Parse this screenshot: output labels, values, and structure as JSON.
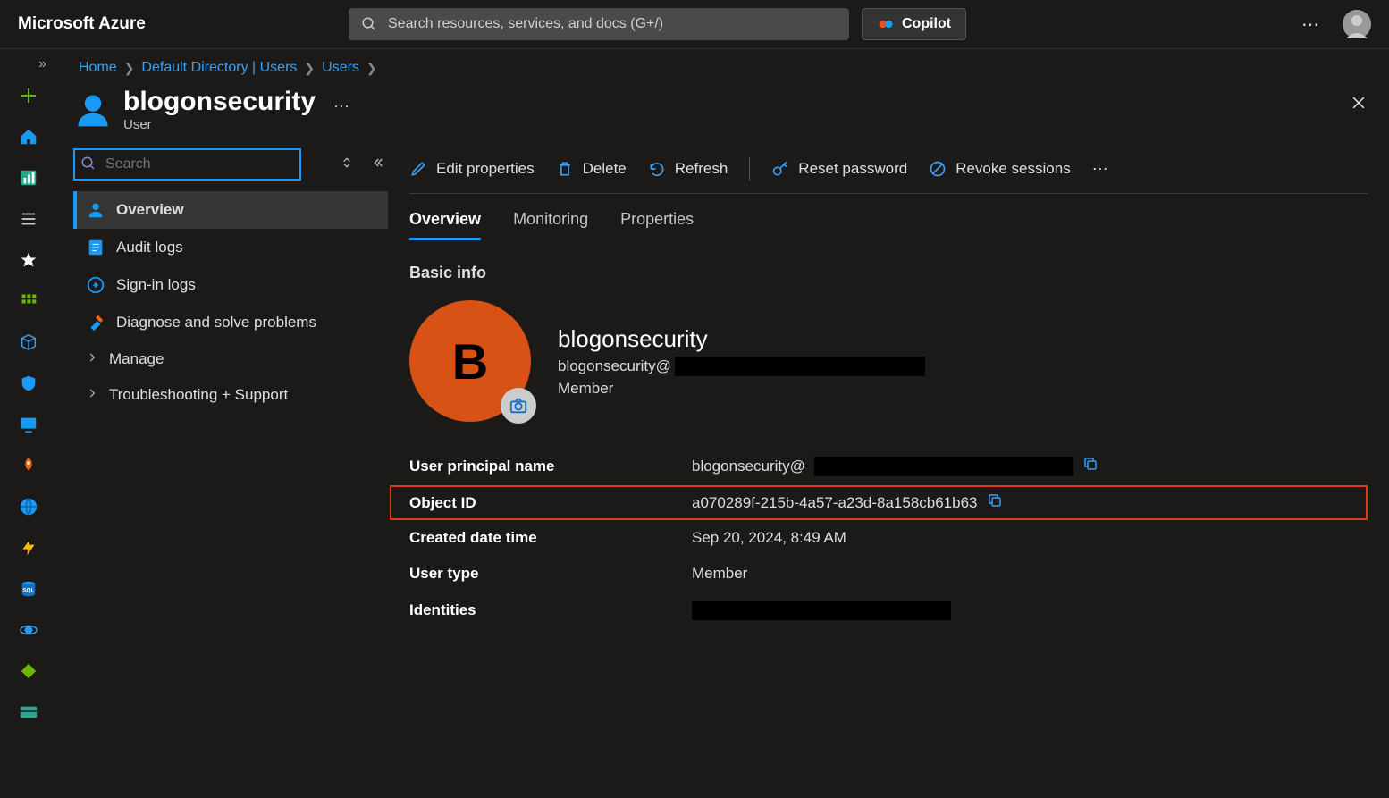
{
  "topbar": {
    "logo": "Microsoft Azure",
    "search_placeholder": "Search resources, services, and docs (G+/)",
    "copilot": "Copilot"
  },
  "breadcrumbs": [
    {
      "label": "Home"
    },
    {
      "label": "Default Directory | Users"
    },
    {
      "label": "Users"
    }
  ],
  "page": {
    "title": "blogonsecurity",
    "subtitle": "User"
  },
  "panel": {
    "search_placeholder": "Search",
    "items": [
      {
        "label": "Overview",
        "icon": "person"
      },
      {
        "label": "Audit logs",
        "icon": "log"
      },
      {
        "label": "Sign-in logs",
        "icon": "signin"
      },
      {
        "label": "Diagnose and solve problems",
        "icon": "tools"
      },
      {
        "label": "Manage",
        "icon": "chev"
      },
      {
        "label": "Troubleshooting + Support",
        "icon": "chev"
      }
    ]
  },
  "toolbar": {
    "edit": "Edit properties",
    "delete": "Delete",
    "refresh": "Refresh",
    "reset": "Reset password",
    "revoke": "Revoke sessions"
  },
  "tabs": [
    {
      "label": "Overview",
      "active": true
    },
    {
      "label": "Monitoring"
    },
    {
      "label": "Properties"
    }
  ],
  "basic": {
    "section_title": "Basic info",
    "initial": "B",
    "display_name": "blogonsecurity",
    "upn_prefix": "blogonsecurity@",
    "member": "Member"
  },
  "props": {
    "upn_label": "User principal name",
    "upn_value": "blogonsecurity@",
    "objectid_label": "Object ID",
    "objectid_value": "a070289f-215b-4a57-a23d-8a158cb61b63",
    "created_label": "Created date time",
    "created_value": "Sep 20, 2024, 8:49 AM",
    "usertype_label": "User type",
    "usertype_value": "Member",
    "identities_label": "Identities"
  }
}
